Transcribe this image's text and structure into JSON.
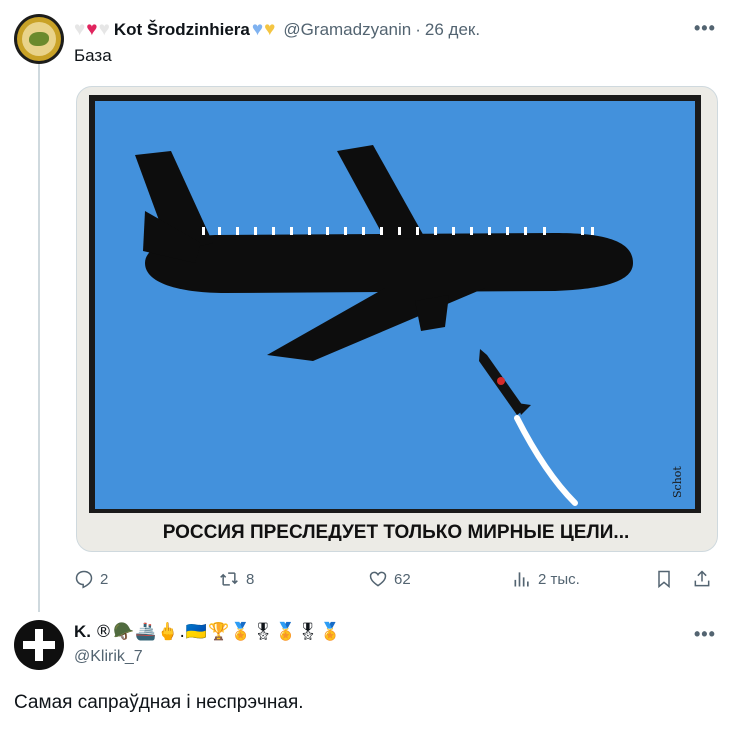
{
  "tweet": {
    "author_name": "Kot Šrodzinhiera",
    "author_handle": "@Gramadzyanin",
    "timestamp": "26 дек.",
    "text": "База",
    "image_caption": "РОССИЯ ПРЕСЛЕДУЕТ ТОЛЬКО МИРНЫЕ ЦЕЛИ...",
    "image_signature": "Schot",
    "stats": {
      "replies": "2",
      "retweets": "8",
      "likes": "62",
      "views": "2 тыс."
    }
  },
  "reply": {
    "author_name": "K.",
    "author_emojis": "®🪖🚢🖕.🇺🇦🏆🏅🎖🏅🎖🏅",
    "author_handle": "@Klirik_7",
    "text": "Самая сапраўдная і неспрэчная."
  },
  "colors": {
    "sky": "#4391dc",
    "accent_red": "#e0245e",
    "muted": "#536471"
  },
  "icons": [
    "more-icon",
    "reply-icon",
    "retweet-icon",
    "like-icon",
    "views-icon",
    "bookmark-icon",
    "share-icon"
  ]
}
